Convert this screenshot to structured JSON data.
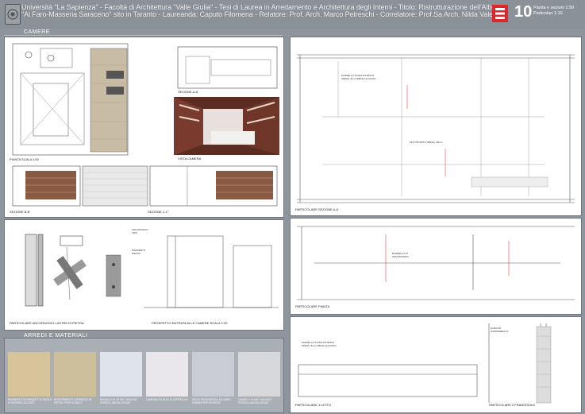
{
  "header": {
    "line1": "Università \"La Sapienza\" - Facoltà di Architettura \"Valle Giulia\" - Tesi di Laurea in Arredamento e Architettura degli Interni - Titolo: Ristrutturazione dell'Albergo",
    "line2": "\"Al Faro-Masseria Saraceno\" sito in Taranto - Laureanda: Caputo Filomena - Relatore: Prof. Arch. Marco Petreschi - Correlatore: Prof.Sa Arch. Nilda Valentin",
    "sheet_number": "10",
    "sheet_label_1": "Pianta e sezioni 1:50",
    "sheet_label_2": "Particolari 1:10"
  },
  "sections": {
    "camere": "CAMERE",
    "arredi": "ARREDI E MATERIALI"
  },
  "captions": {
    "pianta": "PIANTA SCALA 1:50",
    "sez_aa": "SEZIONE A-A'",
    "vista": "VISTA CAMERA",
    "sez_bb": "SEZIONE B-B'",
    "sez_cc": "SEZIONE C-C'",
    "ancoraggio": "PARTICOLARE ANCORAGGIO LASTRE DI PIETRA",
    "prospetto": "PROSPETTO ENTRATA ALLE CAMERE SCALA 1:20",
    "part_sez": "PARTICOLARE SEZIONE A-A'",
    "part_pianta": "PARTICOLARE PIANTA",
    "part_letto": "PARTICOLARE 1 LETTO",
    "part_frangisole": "PARTICOLARE 2 FRANGISOLE"
  },
  "materials": [
    {
      "label": "PAVIMENTO IN PARQUET IN TAVOLE DI ROVERE LACCATO",
      "color": "#d8c49a"
    },
    {
      "label": "RIVESTIMENTO CORRIDOIO IN PIETRA \"FIOR DI MELO\"",
      "color": "#cdbf9c"
    },
    {
      "label": "MOSAICO IN VETRO \"BISAZZA\" PORCELLANOSA GROUP",
      "color": "#dfe3ea"
    },
    {
      "label": "LAMPADA PS 36 DI JS CAPPELLINI",
      "color": "#e9e6ec"
    },
    {
      "label": "SEDIA TRASCINEDDU RICHARD FARMER PER MOROSO",
      "color": "#c9ccd2"
    },
    {
      "label": "LAVABO E PIANO \"MONDEX\" PORCELLANOSA GROUP",
      "color": "#d6d8dc"
    }
  ],
  "colors": {
    "background": "#8e959c",
    "accent": "#e0262b",
    "stone": "#c9bca4",
    "wood": "#8b5a43"
  }
}
